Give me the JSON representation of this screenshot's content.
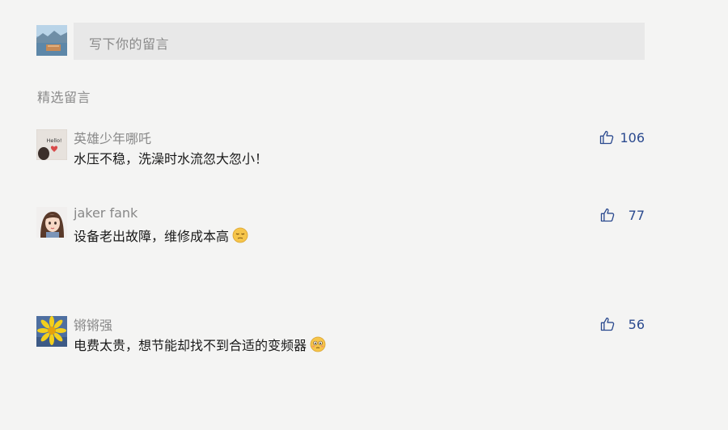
{
  "composer": {
    "placeholder": "写下你的留言"
  },
  "section": {
    "title": "精选留言"
  },
  "comments": [
    {
      "author": "英雄少年哪吒",
      "text": "水压不稳，洗澡时水流忽大忽小！",
      "likes": "106",
      "avatar_text": "Hello!"
    },
    {
      "author": "jaker fank",
      "text": "设备老出故障，维修成本高",
      "likes": "77",
      "emoji": "pensive-face-emoji"
    },
    {
      "author": "锵锵强",
      "text": "电费太贵，想节能却找不到合适的变频器",
      "likes": "56",
      "emoji": "flushed-face-emoji"
    }
  ],
  "colors": {
    "background": "#f4f4f3",
    "input_background": "#e8e8e8",
    "like_blue": "#2b4a8f",
    "muted_text": "#888888"
  }
}
